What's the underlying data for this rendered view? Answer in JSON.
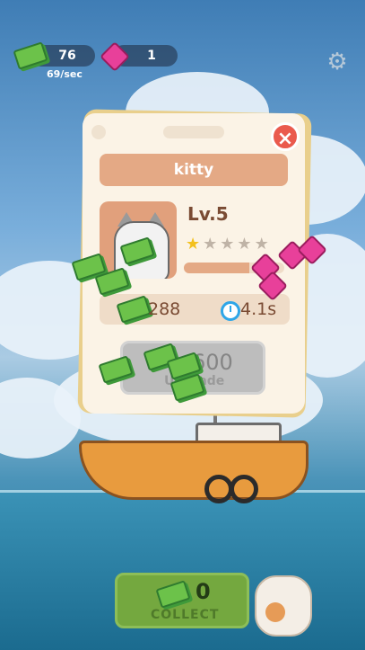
{
  "hud": {
    "cash_value": "76",
    "cash_rate": "69/sec",
    "gem_value": "1",
    "settings_icon": "gear-icon"
  },
  "modal": {
    "name": "kitty",
    "level": "Lv.5",
    "stars_filled": 1,
    "stars_total": 5,
    "xp_progress": 0.65,
    "income": "288",
    "cycle_time": "4.1s",
    "upgrade_cost": "600",
    "upgrade_label": "Upgrade",
    "close_icon": "close-icon"
  },
  "collect": {
    "count": "0",
    "label": "COLLECT"
  },
  "colors": {
    "cash": "#6cc24a",
    "gem": "#e8409a",
    "close": "#ea5a4d",
    "name_bar": "#e4a985",
    "collect": "#74a83f"
  }
}
